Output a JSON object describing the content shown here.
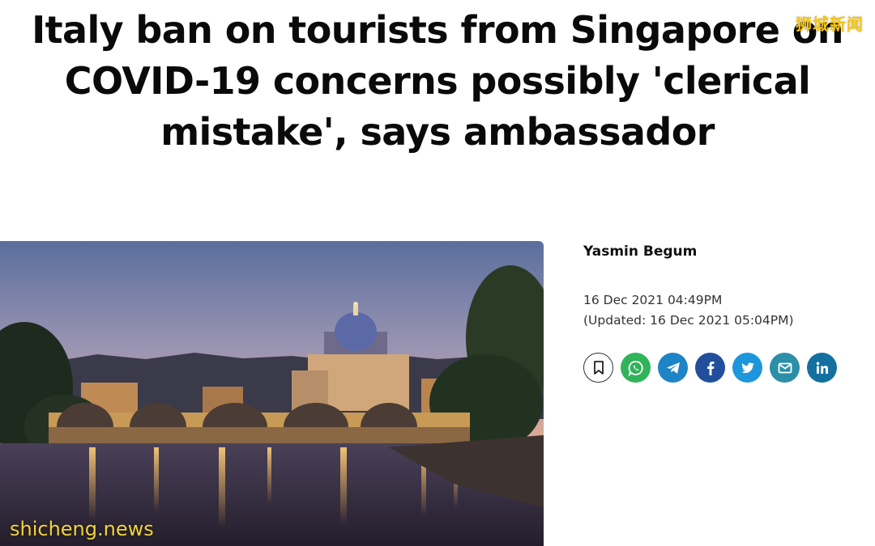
{
  "article": {
    "headline": "Italy ban on tourists from Singapore on COVID-19 concerns possibly 'clerical mistake', says ambassador",
    "author": "Yasmin Begum",
    "published": "16 Dec 2021 04:49PM",
    "updated": "(Updated: 16 Dec 2021 05:04PM)"
  },
  "share": {
    "icons": [
      "bookmark-icon",
      "whatsapp-icon",
      "telegram-icon",
      "facebook-icon",
      "twitter-icon",
      "email-icon",
      "linkedin-icon"
    ],
    "colors": {
      "whatsapp": "#31b35a",
      "telegram": "#1d84c5",
      "facebook": "#214f9c",
      "twitter": "#1e96dc",
      "email": "#2c8fa8",
      "linkedin": "#1470a0"
    }
  },
  "watermarks": {
    "top_right": "狮城新闻",
    "bottom_left": "shicheng.news"
  }
}
